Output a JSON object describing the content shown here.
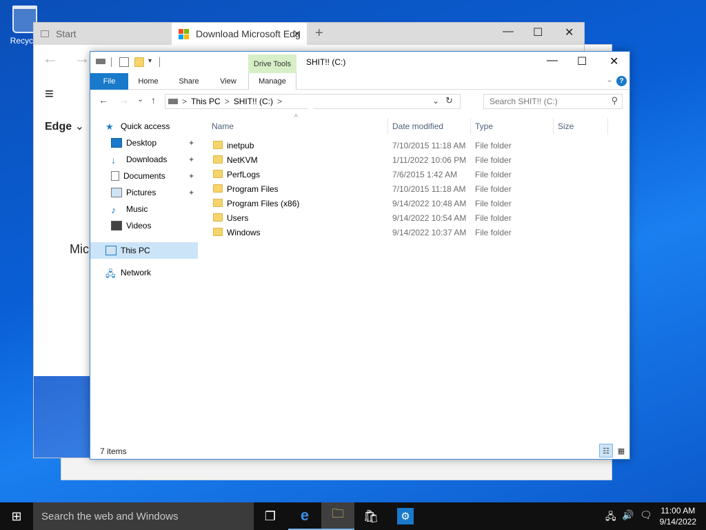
{
  "desktop": {
    "recycle_label": "Recycle"
  },
  "edge": {
    "tab_start": "Start",
    "tab_download": "Download Microsoft Edg",
    "tab_close": "✕",
    "new_tab": "+",
    "minimize": "—",
    "maximize": "☐",
    "close": "✕",
    "menu_icon": "≡",
    "edge_label": "Edge",
    "edge_chevron": "⌄",
    "partial_text": "Mic"
  },
  "explorer": {
    "title": "SHIT!! (C:)",
    "drive_tools": "Drive Tools",
    "ribbon_tabs": {
      "file": "File",
      "home": "Home",
      "share": "Share",
      "view": "View",
      "manage": "Manage"
    },
    "help": "?",
    "nav_back": "←",
    "nav_forward": "→",
    "nav_recent": "⌄",
    "nav_up": "↑",
    "breadcrumb": {
      "sep": ">",
      "this_pc": "This PC",
      "drive": "SHIT!! (C:)",
      "trailing": ">"
    },
    "refresh": "↻",
    "address_dropdown": "⌄",
    "search_placeholder": "Search SHIT!! (C:)",
    "search_icon": "⚲",
    "nav_pane": {
      "quick_access": "Quick access",
      "desktop": "Desktop",
      "downloads": "Downloads",
      "documents": "Documents",
      "pictures": "Pictures",
      "music": "Music",
      "videos": "Videos",
      "this_pc": "This PC",
      "network": "Network",
      "pin": "📌"
    },
    "columns": {
      "name": "Name",
      "date": "Date modified",
      "type": "Type",
      "size": "Size",
      "sort": "^"
    },
    "items": [
      {
        "name": "inetpub",
        "date": "7/10/2015 11:18 AM",
        "type": "File folder"
      },
      {
        "name": "NetKVM",
        "date": "1/11/2022 10:06 PM",
        "type": "File folder"
      },
      {
        "name": "PerfLogs",
        "date": "7/6/2015 1:42 AM",
        "type": "File folder"
      },
      {
        "name": "Program Files",
        "date": "7/10/2015 11:18 AM",
        "type": "File folder"
      },
      {
        "name": "Program Files (x86)",
        "date": "9/14/2022 10:48 AM",
        "type": "File folder"
      },
      {
        "name": "Users",
        "date": "9/14/2022 10:54 AM",
        "type": "File folder"
      },
      {
        "name": "Windows",
        "date": "9/14/2022 10:37 AM",
        "type": "File folder"
      }
    ],
    "status": "7 items",
    "view_details": "☷",
    "view_large": "▦"
  },
  "taskbar": {
    "start_icon": "⊞",
    "search_text": "Search the web and Windows",
    "taskview_icon": "❐",
    "edge_icon": "e",
    "explorer_icon": "🗀",
    "store_icon": "🛍",
    "settings_icon": "⚙",
    "network_icon": "🖧",
    "volume_icon": "🔊",
    "notifications_icon": "🗨",
    "time": "11:00 AM",
    "date": "9/14/2022"
  },
  "colors": {
    "accent": "#1979ca",
    "drive_tools": "#d7efc7",
    "desktop": "#0a5fd6"
  }
}
